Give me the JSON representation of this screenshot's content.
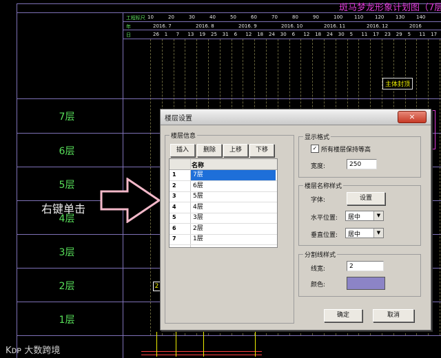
{
  "background_title": "斑马梦龙形象计划图（7层",
  "schedule_header": {
    "row_labels": [
      "工程标尺",
      "年",
      "日"
    ],
    "scale": [
      "10",
      "20",
      "30",
      "40",
      "50",
      "60",
      "70",
      "80",
      "90",
      "100",
      "110",
      "120",
      "130",
      "140"
    ],
    "months": [
      "2016. 7",
      "2016. 8",
      "2016. 9",
      "2016. 10",
      "2016. 11",
      "2016. 12",
      "2016"
    ],
    "days": [
      "26",
      "1",
      "7",
      "13",
      "19",
      "25",
      "31",
      "6",
      "12",
      "18",
      "24",
      "30",
      "6",
      "12",
      "18",
      "24",
      "30",
      "5",
      "11",
      "17",
      "23",
      "29",
      "5",
      "11",
      "17"
    ]
  },
  "floors": [
    "7层",
    "6层",
    "5层",
    "4层",
    "3层",
    "2层",
    "1层"
  ],
  "milestone_label": "主体封顶",
  "annotation_text": "右键单击",
  "watermark_text": "大数跨境",
  "watermark_logo": "Kᴅᴘ",
  "side_marker": "2",
  "dialog": {
    "title": "楼层设置",
    "close_label": "×",
    "floor_info_group": "楼层信息",
    "buttons": {
      "insert": "插入",
      "delete": "删除",
      "move_up": "上移",
      "move_down": "下移"
    },
    "table_header": "名称",
    "rows": [
      {
        "idx": "1",
        "name": "7层"
      },
      {
        "idx": "2",
        "name": "6层"
      },
      {
        "idx": "3",
        "name": "5层"
      },
      {
        "idx": "4",
        "name": "4层"
      },
      {
        "idx": "5",
        "name": "3层"
      },
      {
        "idx": "6",
        "name": "2层"
      },
      {
        "idx": "7",
        "name": "1层"
      }
    ],
    "display_group": "显示格式",
    "equal_height_label": "所有楼层保持等高",
    "equal_height_checked": "✓",
    "width_label": "宽度:",
    "width_value": "250",
    "name_style_group": "楼层名称样式",
    "font_label": "字体:",
    "font_button": "设置",
    "h_align_label": "水平位置:",
    "h_align_value": "居中",
    "v_align_label": "垂直位置:",
    "v_align_value": "居中",
    "divider_group": "分割线样式",
    "line_width_label": "线宽:",
    "line_width_value": "2",
    "color_label": "颜色:",
    "color_value": "#8c84c6",
    "ok_label": "确定",
    "cancel_label": "取消"
  }
}
